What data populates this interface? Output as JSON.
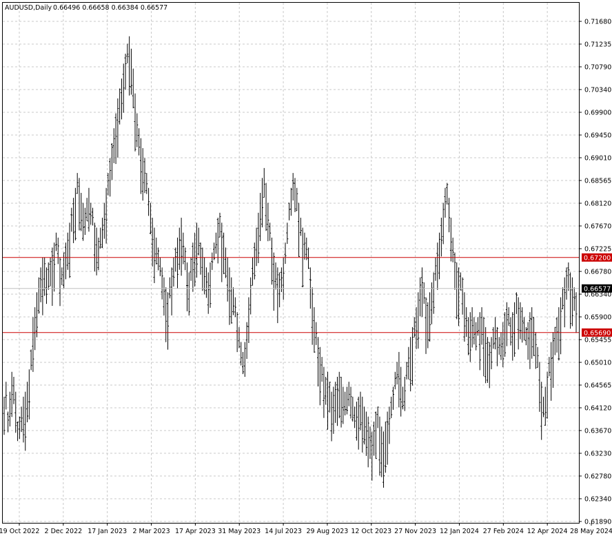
{
  "header": {
    "symbol_timeframe": "AUDUSD,Daily",
    "ohlc": "0.66496 0.66658 0.66384 0.66577"
  },
  "colors": {
    "background": "#ffffff",
    "grid": "#c8c8c8",
    "bars": "#000000",
    "level_line": "#cc0000",
    "level_label_bg": "#cc0000",
    "current_price_bg": "#000000",
    "current_price_line": "#c0c0c0"
  },
  "chart_data": {
    "type": "ohlc",
    "grid": true,
    "y_axis_position": "right",
    "ylim": [
      0.6189,
      0.7195
    ],
    "price_ticks": [
      "0.71680",
      "0.71235",
      "0.70790",
      "0.70340",
      "0.69900",
      "0.69450",
      "0.69010",
      "0.68565",
      "0.68120",
      "0.67670",
      "0.67225",
      "0.66780",
      "0.66340",
      "0.65900",
      "0.65455",
      "0.65010",
      "0.64565",
      "0.64120",
      "0.63670",
      "0.63230",
      "0.62780",
      "0.62340",
      "0.61890"
    ],
    "date_ticks": [
      "19 Oct 2022",
      "2 Dec 2022",
      "17 Jan 2023",
      "2 Mar 2023",
      "17 Apr 2023",
      "31 May 2023",
      "14 Jul 2023",
      "29 Aug 2023",
      "12 Oct 2023",
      "27 Nov 2023",
      "12 Jan 2024",
      "27 Feb 2024",
      "12 Apr 2024",
      "28 May 2024"
    ],
    "horizontal_levels": [
      {
        "label": "0.67200",
        "value": 0.672
      },
      {
        "label": "0.65690",
        "value": 0.6569
      }
    ],
    "current_price": {
      "label": "0.66577",
      "value": 0.66577
    },
    "last_bar": {
      "open": 0.66496,
      "high": 0.66658,
      "low": 0.66384,
      "close": 0.66577
    },
    "approx_daily_highs": [
      0.644,
      0.647,
      0.641,
      0.645,
      0.649,
      0.648,
      0.645,
      0.639,
      0.64,
      0.642,
      0.644,
      0.645,
      0.647,
      0.6495,
      0.6535,
      0.66,
      0.662,
      0.665,
      0.668,
      0.67,
      0.672,
      0.672,
      0.67,
      0.671,
      0.672,
      0.674,
      0.675,
      0.677,
      0.676,
      0.672,
      0.67,
      0.673,
      0.675,
      0.677,
      0.679,
      0.682,
      0.684,
      0.686,
      0.689,
      0.688,
      0.685,
      0.683,
      0.682,
      0.684,
      0.686,
      0.683,
      0.682,
      0.679,
      0.678,
      0.676,
      0.678,
      0.68,
      0.683,
      0.686,
      0.689,
      0.692,
      0.695,
      0.698,
      0.701,
      0.704,
      0.706,
      0.708,
      0.711,
      0.713,
      0.715,
      0.7165,
      0.714,
      0.71,
      0.705,
      0.701,
      0.698,
      0.696,
      0.694,
      0.692,
      0.689,
      0.686,
      0.683,
      0.68,
      0.678,
      0.676,
      0.674,
      0.672,
      0.67,
      0.668,
      0.666,
      0.665,
      0.668,
      0.67,
      0.672,
      0.674,
      0.676,
      0.678,
      0.68,
      0.677,
      0.674,
      0.671,
      0.669,
      0.672,
      0.675,
      0.677,
      0.679,
      0.678,
      0.675,
      0.674,
      0.672,
      0.67,
      0.669,
      0.671,
      0.673,
      0.675,
      0.677,
      0.68,
      0.681,
      0.679,
      0.677,
      0.674,
      0.672,
      0.67,
      0.668,
      0.666,
      0.664,
      0.661,
      0.658,
      0.655,
      0.653,
      0.655,
      0.659,
      0.664,
      0.668,
      0.672,
      0.675,
      0.678,
      0.681,
      0.685,
      0.688,
      0.69,
      0.687,
      0.683,
      0.679,
      0.676,
      0.673,
      0.671,
      0.67,
      0.669,
      0.67,
      0.672,
      0.675,
      0.679,
      0.683,
      0.686,
      0.689,
      0.688,
      0.686,
      0.683,
      0.68,
      0.678,
      0.677,
      0.676,
      0.674,
      0.67,
      0.666,
      0.662,
      0.659,
      0.656,
      0.654,
      0.652,
      0.65,
      0.648,
      0.649,
      0.647,
      0.645,
      0.646,
      0.647,
      0.648,
      0.649,
      0.648,
      0.646,
      0.645,
      0.646,
      0.647,
      0.646,
      0.644,
      0.642,
      0.643,
      0.644,
      0.645,
      0.644,
      0.642,
      0.641,
      0.64,
      0.638,
      0.637,
      0.639,
      0.641,
      0.642,
      0.64,
      0.638,
      0.637,
      0.639,
      0.641,
      0.642,
      0.644,
      0.646,
      0.649,
      0.651,
      0.653,
      0.65,
      0.646,
      0.648,
      0.651,
      0.654,
      0.656,
      0.658,
      0.66,
      0.662,
      0.665,
      0.668,
      0.67,
      0.667,
      0.664,
      0.663,
      0.665,
      0.667,
      0.669,
      0.672,
      0.675,
      0.677,
      0.68,
      0.683,
      0.686,
      0.687,
      0.684,
      0.68,
      0.676,
      0.673,
      0.671,
      0.67,
      0.669,
      0.668,
      0.665,
      0.662,
      0.66,
      0.661,
      0.662,
      0.66,
      0.659,
      0.66,
      0.661,
      0.662,
      0.66,
      0.658,
      0.656,
      0.655,
      0.656,
      0.658,
      0.66,
      0.658,
      0.656,
      0.657,
      0.659,
      0.661,
      0.663,
      0.662,
      0.66,
      0.661,
      0.663,
      0.665,
      0.664,
      0.663,
      0.662,
      0.66,
      0.658,
      0.659,
      0.661,
      0.662,
      0.66,
      0.657,
      0.654,
      0.651,
      0.647,
      0.644,
      0.646,
      0.649,
      0.652,
      0.655,
      0.657,
      0.658,
      0.66,
      0.662,
      0.664,
      0.666,
      0.668,
      0.67,
      0.671,
      0.669,
      0.668,
      0.666,
      0.665
    ]
  }
}
